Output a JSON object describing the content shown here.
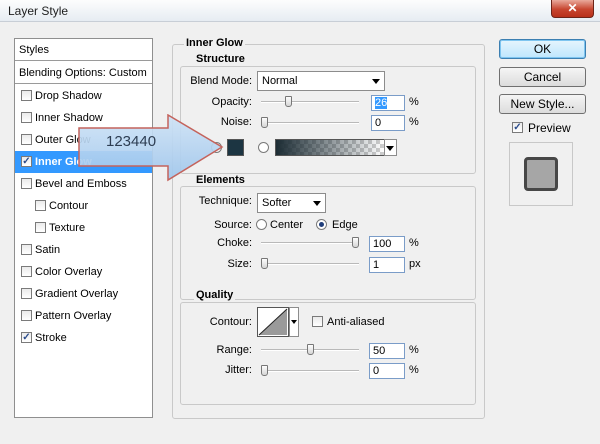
{
  "window": {
    "title": "Layer Style",
    "close_label": "✕"
  },
  "styles_list": {
    "header": "Styles",
    "blending": "Blending Options: Custom",
    "items": [
      {
        "label": "Drop Shadow",
        "checked": false,
        "selected": false,
        "indent": false
      },
      {
        "label": "Inner Shadow",
        "checked": false,
        "selected": false,
        "indent": false
      },
      {
        "label": "Outer Glow",
        "checked": false,
        "selected": false,
        "indent": false
      },
      {
        "label": "Inner Glow",
        "checked": true,
        "selected": true,
        "indent": false
      },
      {
        "label": "Bevel and Emboss",
        "checked": false,
        "selected": false,
        "indent": false
      },
      {
        "label": "Contour",
        "checked": false,
        "selected": false,
        "indent": true
      },
      {
        "label": "Texture",
        "checked": false,
        "selected": false,
        "indent": true
      },
      {
        "label": "Satin",
        "checked": false,
        "selected": false,
        "indent": false
      },
      {
        "label": "Color Overlay",
        "checked": false,
        "selected": false,
        "indent": false
      },
      {
        "label": "Gradient Overlay",
        "checked": false,
        "selected": false,
        "indent": false
      },
      {
        "label": "Pattern Overlay",
        "checked": false,
        "selected": false,
        "indent": false
      },
      {
        "label": "Stroke",
        "checked": true,
        "selected": false,
        "indent": false
      }
    ]
  },
  "inner_glow": {
    "title": "Inner Glow",
    "structure": {
      "title": "Structure",
      "blend_mode_label": "Blend Mode:",
      "blend_mode_value": "Normal",
      "opacity_label": "Opacity:",
      "opacity_value": "26",
      "opacity_unit": "%",
      "opacity_fraction": 0.26,
      "noise_label": "Noise:",
      "noise_value": "0",
      "noise_unit": "%",
      "noise_fraction": 0.0,
      "glow_color": "#1c3542"
    },
    "elements": {
      "title": "Elements",
      "technique_label": "Technique:",
      "technique_value": "Softer",
      "source_label": "Source:",
      "source_center": "Center",
      "source_edge": "Edge",
      "choke_label": "Choke:",
      "choke_value": "100",
      "choke_unit": "%",
      "choke_fraction": 1.0,
      "size_label": "Size:",
      "size_value": "1",
      "size_unit": "px",
      "size_fraction": 0.0
    },
    "quality": {
      "title": "Quality",
      "contour_label": "Contour:",
      "anti_aliased_label": "Anti-aliased",
      "range_label": "Range:",
      "range_value": "50",
      "range_unit": "%",
      "range_fraction": 0.5,
      "jitter_label": "Jitter:",
      "jitter_value": "0",
      "jitter_unit": "%",
      "jitter_fraction": 0.0
    }
  },
  "buttons": {
    "ok": "OK",
    "cancel": "Cancel",
    "new_style": "New Style..."
  },
  "preview": {
    "label": "Preview",
    "checked": true
  },
  "annotation": {
    "text": "123440"
  }
}
